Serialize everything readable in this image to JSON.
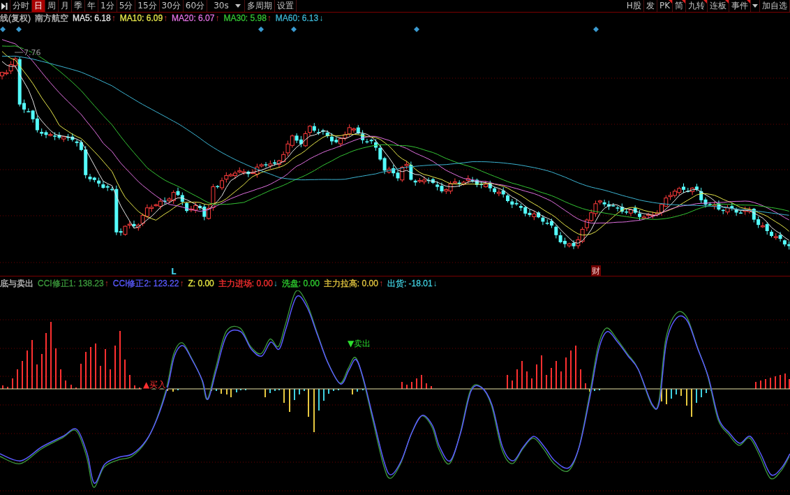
{
  "toolbar": {
    "periods": [
      {
        "label": "分时",
        "selected": false
      },
      {
        "label": "日",
        "selected": true
      },
      {
        "label": "周",
        "selected": false
      },
      {
        "label": "月",
        "selected": false
      },
      {
        "label": "季",
        "selected": false
      },
      {
        "label": "年",
        "selected": false
      },
      {
        "label": "1分",
        "selected": false
      },
      {
        "label": "5分",
        "selected": false
      },
      {
        "label": "15分",
        "selected": false
      },
      {
        "label": "30分",
        "selected": false
      },
      {
        "label": "60分",
        "selected": false
      },
      {
        "label": "30s",
        "selected": false,
        "kind": "select"
      },
      {
        "label": "多周期",
        "selected": false
      },
      {
        "label": "设置",
        "selected": false
      }
    ],
    "tools": [
      {
        "kind": "button",
        "label": "H股",
        "flagged": false
      },
      {
        "kind": "button",
        "label": "发",
        "flagged": false
      },
      {
        "kind": "button",
        "label": "PK",
        "flagged": true
      },
      {
        "kind": "button",
        "label": "简",
        "flagged": true
      },
      {
        "kind": "button",
        "label": "九转",
        "flagged": true
      },
      {
        "kind": "button",
        "label": "连板",
        "flagged": true
      },
      {
        "kind": "button",
        "label": "事件",
        "flagged": true
      },
      {
        "kind": "menu"
      },
      {
        "kind": "button",
        "label": "加自选",
        "flagged": false
      }
    ]
  },
  "price_chart": {
    "period": "线(复权)",
    "stock": "南方航空",
    "moving_averages": [
      {
        "label": "MA5: 6.18",
        "arrow": "↑",
        "rising": true,
        "color": "#e6e6e6"
      },
      {
        "label": "MA10: 6.09",
        "arrow": "↑",
        "rising": true,
        "color": "#e6e64a"
      },
      {
        "label": "MA20: 6.07",
        "arrow": "↑",
        "rising": true,
        "color": "#e070e0"
      },
      {
        "label": "MA30: 5.98",
        "arrow": "↑",
        "rising": true,
        "color": "#34c434"
      },
      {
        "label": "MA60: 6.13",
        "arrow": "↓",
        "rising": false,
        "color": "#3cb4d2"
      }
    ],
    "high_label": "7.76",
    "markers": [
      {
        "kind": "letter",
        "text": "L"
      },
      {
        "kind": "badge",
        "text": "财"
      }
    ]
  },
  "indicator_chart": {
    "title": "底与卖出",
    "series": [
      {
        "label": "CCI修正1: 138.23",
        "arrow": "↑",
        "rising": true,
        "color": "#3c9a3c"
      },
      {
        "label": "CCI修正2: 123.22",
        "arrow": "↑",
        "rising": true,
        "color": "#5a5aff"
      },
      {
        "label": "Z: 0.00",
        "color": "#e6e640"
      },
      {
        "label": "主力进场: 0.00",
        "arrow": "↓",
        "rising": false,
        "color": "#ff3030"
      },
      {
        "label": "洗盘: 0.00",
        "color": "#30d030"
      },
      {
        "label": "主力拉高: 0.00",
        "arrow": "↑",
        "rising": true,
        "color": "#e6c840"
      },
      {
        "label": "出货: -18.01",
        "arrow": "↓",
        "rising": false,
        "color": "#40d0e0"
      }
    ],
    "signals": [
      {
        "kind": "buy",
        "text": "▲买入"
      },
      {
        "kind": "sell",
        "text": "▼卖出"
      }
    ]
  }
}
